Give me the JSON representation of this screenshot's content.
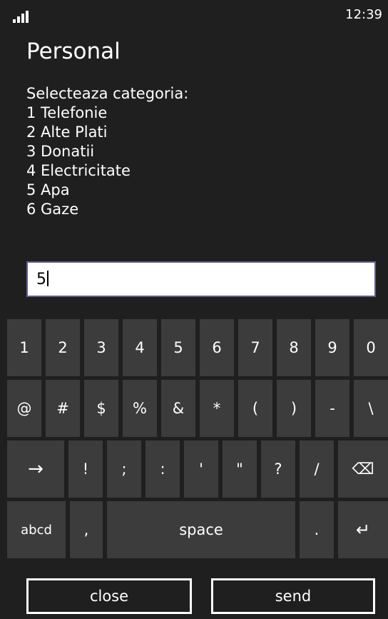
{
  "status": {
    "time": "12:39",
    "signal_icon": "signal-strength-icon"
  },
  "title": "Personal",
  "prompt": {
    "heading": "Selecteaza categoria:",
    "options": [
      "1 Telefonie",
      "2 Alte Plati",
      "3 Donatii",
      "4 Electricitate",
      "5 Apa",
      "6 Gaze"
    ]
  },
  "input": {
    "value": "5"
  },
  "keyboard": {
    "row1": [
      "1",
      "2",
      "3",
      "4",
      "5",
      "6",
      "7",
      "8",
      "9",
      "0"
    ],
    "row2": [
      "@",
      "#",
      "$",
      "%",
      "&",
      "*",
      "(",
      ")",
      "-",
      "\\"
    ],
    "row3": [
      "!",
      ";",
      ":",
      "'",
      "\"",
      "?",
      "/"
    ],
    "row3_icons": {
      "shift": "→",
      "backspace": "⌫"
    },
    "row4": {
      "abc": "abcd",
      "comma": ",",
      "space": "space",
      "period": ".",
      "enter": "↵"
    }
  },
  "app_bar": {
    "close": "close",
    "send": "send"
  },
  "colors": {
    "background": "#1f1f1f",
    "key": "#3c3c3c",
    "input_border": "#6b5b8f"
  }
}
